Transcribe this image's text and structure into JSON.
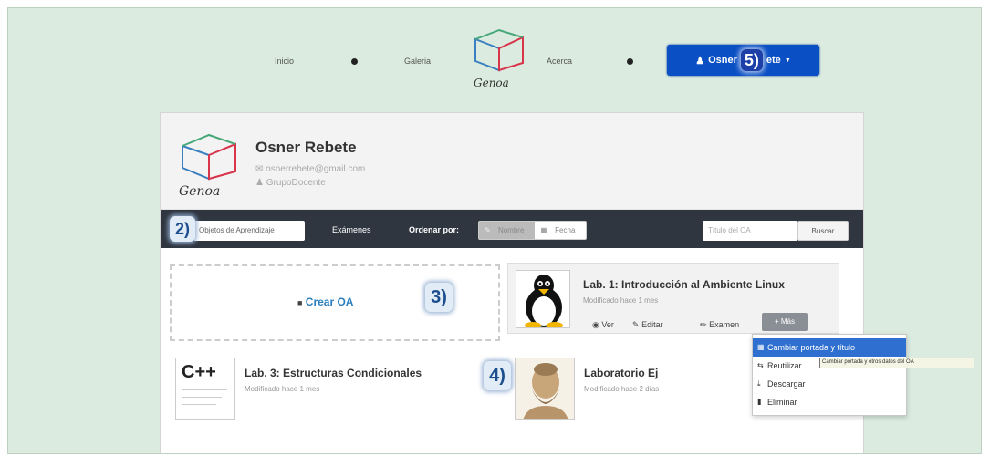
{
  "nav": {
    "inicio": "Inicio",
    "galeria": "Galeria",
    "acerca": "Acerca",
    "logo_text": "Genoa",
    "user_label": "Osner",
    "user_label_tail": "ete",
    "user_badge": "5)"
  },
  "profile": {
    "name": "Osner Rebete",
    "email": "osnerrebete@gmail.com",
    "group": "GrupoDocente",
    "logo_text": "Genoa"
  },
  "toolbar": {
    "badge": "2)",
    "active_tab": "Objetos de Aprendizaje",
    "exams_tab": "Exámenes",
    "order_label": "Ordenar por:",
    "order_name": "Nombre",
    "order_date": "Fecha",
    "search_placeholder": "Título del OA",
    "search_button": "Buscar"
  },
  "create": {
    "label": "Crear OA",
    "badge": "3)"
  },
  "items": [
    {
      "title": "Lab. 1: Introducción al Ambiente Linux",
      "modified": "Modificado hace 1 mes",
      "actions": {
        "ver": "Ver",
        "editar": "Editar",
        "examen": "Examen",
        "mas": "Más"
      }
    },
    {
      "title": "Lab. 3: Estructuras Condicionales",
      "modified": "Modificado hace 1 mes",
      "thumb_text": "C++"
    },
    {
      "title": "Laboratorio Ej",
      "modified": "Modificado hace 2 días"
    }
  ],
  "item_badge": "4)",
  "dropdown": {
    "items": [
      "Cambiar portada y título",
      "Reutilizar",
      "Descargar",
      "Eliminar"
    ]
  },
  "tooltip": "Cambiar portada y otros datos del OA",
  "colors": {
    "background": "#dbebdf",
    "user_button": "#0a4fc4",
    "toolbar": "#2f3640",
    "link": "#2a7fc0",
    "dropdown_active": "#2e6fcf"
  }
}
